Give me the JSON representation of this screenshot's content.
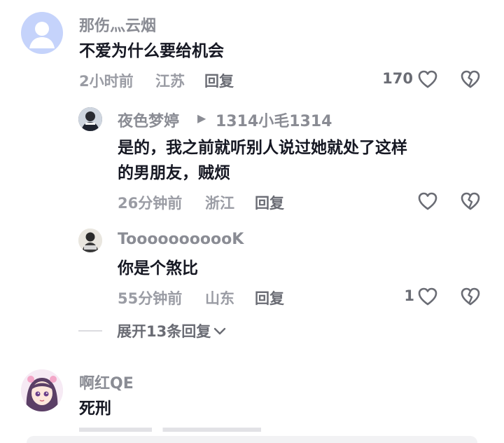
{
  "comments": [
    {
      "username": "那伤灬云烟",
      "text_lines": [
        "不爱为什么要给机会"
      ],
      "time": "2小时前",
      "location": "江苏",
      "reply_label": "回复",
      "like_count": "170"
    }
  ],
  "replies": [
    {
      "username": "夜色梦婷",
      "arrow": "▶",
      "reply_to": "1314小毛1314",
      "text_lines": [
        "是的，我之前就听别人说过她就处了这样",
        "的男朋友，贼烦"
      ],
      "time": "26分钟前",
      "location": "浙江",
      "reply_label": "回复",
      "like_count": ""
    },
    {
      "username": "TooooooooooK",
      "text_lines": [
        "你是个煞比"
      ],
      "time": "55分钟前",
      "location": "山东",
      "reply_label": "回复",
      "like_count": "1"
    }
  ],
  "expand_label": "展开13条回复",
  "comments2": [
    {
      "username": "啊红QE",
      "text_lines": [
        "死刑"
      ]
    }
  ],
  "colors": {
    "text_primary": "#161823",
    "text_secondary": "#8a8c94",
    "icon_stroke": "#6a6c74",
    "default_avatar": "#c5d3fb"
  },
  "icons": [
    "heart-outline-icon",
    "broken-heart-icon",
    "chevron-down-icon"
  ]
}
